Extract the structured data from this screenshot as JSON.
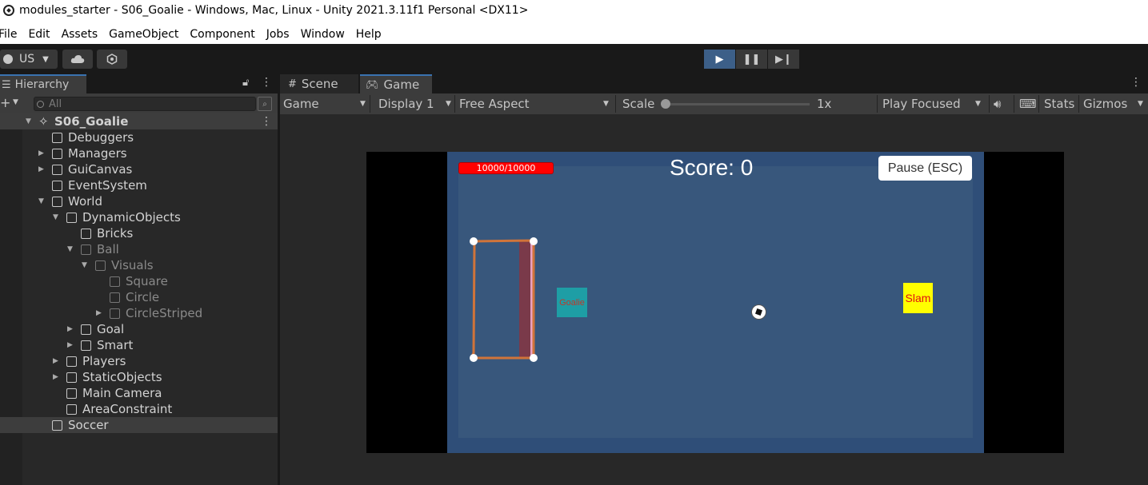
{
  "window": {
    "title": "modules_starter - S06_Goalie - Windows, Mac, Linux - Unity 2021.3.11f1 Personal <DX11>"
  },
  "menu": [
    "File",
    "Edit",
    "Assets",
    "GameObject",
    "Component",
    "Jobs",
    "Window",
    "Help"
  ],
  "toolbar": {
    "account_label": "US",
    "play_state": "playing"
  },
  "hierarchy": {
    "tab_label": "Hierarchy",
    "search_placeholder": "All",
    "scene_name": "S06_Goalie",
    "items": [
      {
        "label": "Debuggers",
        "depth": 1,
        "expander": ""
      },
      {
        "label": "Managers",
        "depth": 1,
        "expander": "▶"
      },
      {
        "label": "GuiCanvas",
        "depth": 1,
        "expander": "▶"
      },
      {
        "label": "EventSystem",
        "depth": 1,
        "expander": ""
      },
      {
        "label": "World",
        "depth": 1,
        "expander": "▼"
      },
      {
        "label": "DynamicObjects",
        "depth": 2,
        "expander": "▼"
      },
      {
        "label": "Bricks",
        "depth": 3,
        "expander": ""
      },
      {
        "label": "Ball",
        "depth": 3,
        "expander": "▼",
        "dim": true
      },
      {
        "label": "Visuals",
        "depth": 4,
        "expander": "▼",
        "dim": true
      },
      {
        "label": "Square",
        "depth": 5,
        "expander": "",
        "dim": true
      },
      {
        "label": "Circle",
        "depth": 5,
        "expander": "",
        "dim": true
      },
      {
        "label": "CircleStriped",
        "depth": 5,
        "expander": "▶",
        "dim": true
      },
      {
        "label": "Goal",
        "depth": 3,
        "expander": "▶"
      },
      {
        "label": "Smart",
        "depth": 3,
        "expander": "▶"
      },
      {
        "label": "Players",
        "depth": 2,
        "expander": "▶"
      },
      {
        "label": "StaticObjects",
        "depth": 2,
        "expander": "▶"
      },
      {
        "label": "Main Camera",
        "depth": 2,
        "expander": ""
      },
      {
        "label": "AreaConstraint",
        "depth": 2,
        "expander": ""
      },
      {
        "label": "Soccer",
        "depth": 1,
        "expander": "",
        "selected": true
      }
    ]
  },
  "game_panel": {
    "tabs": {
      "scene": "Scene",
      "game": "Game"
    },
    "controls": {
      "view": "Game",
      "display": "Display 1",
      "aspect": "Free Aspect",
      "scale_label": "Scale",
      "scale_value": "1x",
      "play_mode": "Play Focused",
      "stats": "Stats",
      "gizmos": "Gizmos"
    },
    "game": {
      "health": "10000/10000",
      "score": "Score: 0",
      "pause_button": "Pause (ESC)",
      "goalie_label": "Goalie",
      "slam_label": "Slam"
    }
  },
  "colors": {
    "accent": "#3a72b0",
    "play_active": "#3c5f88",
    "field": "#2f4e78",
    "health_bar": "#ff0000",
    "goal_outline": "#d0743a"
  }
}
